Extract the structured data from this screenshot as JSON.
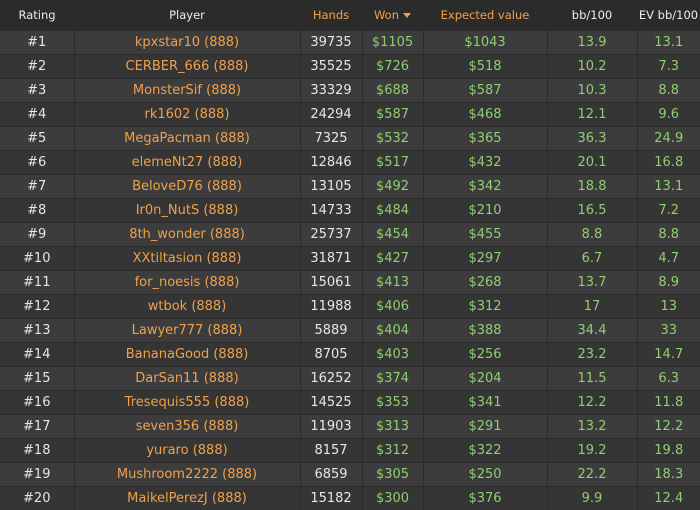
{
  "headers": {
    "rating": "Rating",
    "player": "Player",
    "hands": "Hands",
    "won": "Won",
    "expected": "Expected value",
    "bb100": "bb/100",
    "evbb100": "EV bb/100"
  },
  "sort_icon": "caret-down-icon",
  "colors": {
    "orange_text": "#f0a04b",
    "green_text": "#8fce73",
    "background": "#3a3a3a"
  },
  "rows": [
    {
      "rank": "#1",
      "player": "kpxstar10 (888)",
      "hands": "39735",
      "won": "$1105",
      "ev": "$1043",
      "bb": "13.9",
      "evbb": "13.1"
    },
    {
      "rank": "#2",
      "player": "CERBER_666 (888)",
      "hands": "35525",
      "won": "$726",
      "ev": "$518",
      "bb": "10.2",
      "evbb": "7.3"
    },
    {
      "rank": "#3",
      "player": "MonsterSif (888)",
      "hands": "33329",
      "won": "$688",
      "ev": "$587",
      "bb": "10.3",
      "evbb": "8.8"
    },
    {
      "rank": "#4",
      "player": "rk1602 (888)",
      "hands": "24294",
      "won": "$587",
      "ev": "$468",
      "bb": "12.1",
      "evbb": "9.6"
    },
    {
      "rank": "#5",
      "player": "MegaPacman (888)",
      "hands": "7325",
      "won": "$532",
      "ev": "$365",
      "bb": "36.3",
      "evbb": "24.9"
    },
    {
      "rank": "#6",
      "player": "elemeNt27 (888)",
      "hands": "12846",
      "won": "$517",
      "ev": "$432",
      "bb": "20.1",
      "evbb": "16.8"
    },
    {
      "rank": "#7",
      "player": "BeloveD76 (888)",
      "hands": "13105",
      "won": "$492",
      "ev": "$342",
      "bb": "18.8",
      "evbb": "13.1"
    },
    {
      "rank": "#8",
      "player": "Ir0n_NutS (888)",
      "hands": "14733",
      "won": "$484",
      "ev": "$210",
      "bb": "16.5",
      "evbb": "7.2"
    },
    {
      "rank": "#9",
      "player": "8th_wonder (888)",
      "hands": "25737",
      "won": "$454",
      "ev": "$455",
      "bb": "8.8",
      "evbb": "8.8"
    },
    {
      "rank": "#10",
      "player": "XXtiltasion (888)",
      "hands": "31871",
      "won": "$427",
      "ev": "$297",
      "bb": "6.7",
      "evbb": "4.7"
    },
    {
      "rank": "#11",
      "player": "for_noesis (888)",
      "hands": "15061",
      "won": "$413",
      "ev": "$268",
      "bb": "13.7",
      "evbb": "8.9"
    },
    {
      "rank": "#12",
      "player": "wtbok (888)",
      "hands": "11988",
      "won": "$406",
      "ev": "$312",
      "bb": "17",
      "evbb": "13"
    },
    {
      "rank": "#13",
      "player": "Lawyer777 (888)",
      "hands": "5889",
      "won": "$404",
      "ev": "$388",
      "bb": "34.4",
      "evbb": "33"
    },
    {
      "rank": "#14",
      "player": "BananaGood (888)",
      "hands": "8705",
      "won": "$403",
      "ev": "$256",
      "bb": "23.2",
      "evbb": "14.7"
    },
    {
      "rank": "#15",
      "player": "DarSan11 (888)",
      "hands": "16252",
      "won": "$374",
      "ev": "$204",
      "bb": "11.5",
      "evbb": "6.3"
    },
    {
      "rank": "#16",
      "player": "Tresequis555 (888)",
      "hands": "14525",
      "won": "$353",
      "ev": "$341",
      "bb": "12.2",
      "evbb": "11.8"
    },
    {
      "rank": "#17",
      "player": "seven356 (888)",
      "hands": "11903",
      "won": "$313",
      "ev": "$291",
      "bb": "13.2",
      "evbb": "12.2"
    },
    {
      "rank": "#18",
      "player": "yuraro (888)",
      "hands": "8157",
      "won": "$312",
      "ev": "$322",
      "bb": "19.2",
      "evbb": "19.8"
    },
    {
      "rank": "#19",
      "player": "Mushroom2222 (888)",
      "hands": "6859",
      "won": "$305",
      "ev": "$250",
      "bb": "22.2",
      "evbb": "18.3"
    },
    {
      "rank": "#20",
      "player": "MaikelPerezJ (888)",
      "hands": "15182",
      "won": "$300",
      "ev": "$376",
      "bb": "9.9",
      "evbb": "12.4"
    }
  ]
}
